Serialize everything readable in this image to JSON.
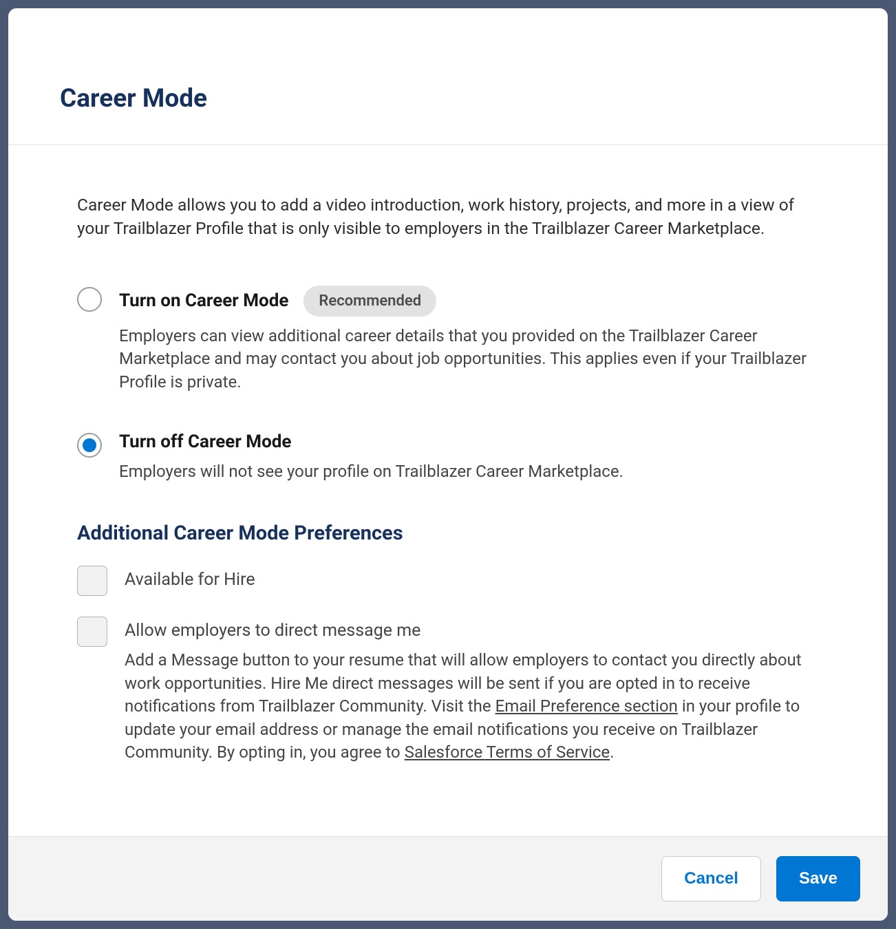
{
  "modal": {
    "title": "Career Mode",
    "intro": "Career Mode allows you to add a video introduction, work history, projects, and more in a view of your Trailblazer Profile that is only visible to employers in the Trailblazer Career Marketplace.",
    "options": {
      "on": {
        "label": "Turn on Career Mode",
        "badge": "Recommended",
        "description": "Employers can view additional career details that you provided on the Trailblazer Career Marketplace and may contact you about job opportunities. This applies even if your Trailblazer Profile is private."
      },
      "off": {
        "label": "Turn off Career Mode",
        "description": "Employers will not see your profile on Trailblazer Career Marketplace."
      }
    },
    "preferences": {
      "heading": "Additional Career Mode Preferences",
      "available": {
        "label": "Available for Hire"
      },
      "dm": {
        "label": "Allow employers to direct message me",
        "desc_part1": "Add a Message button to your resume that will allow employers to contact you directly about work opportunities. Hire Me direct messages will be sent if you are opted in to receive notifications from Trailblazer Community. Visit the ",
        "link1": "Email Preference section",
        "desc_part2": " in your profile to update your email address or manage the email notifications you receive on Trailblazer Community. By opting in, you agree to ",
        "link2": "Salesforce Terms of Service",
        "desc_part3": "."
      }
    },
    "footer": {
      "cancel": "Cancel",
      "save": "Save"
    }
  }
}
